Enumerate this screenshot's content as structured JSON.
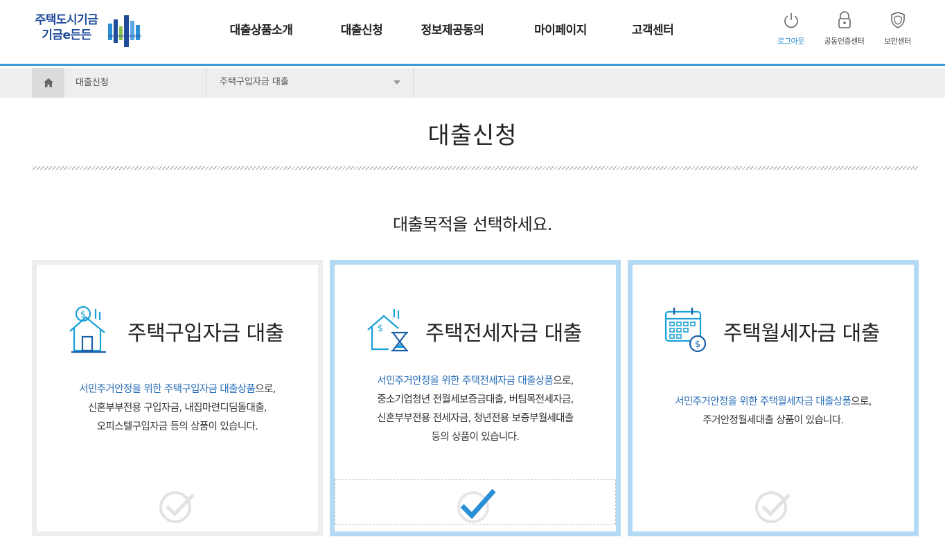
{
  "logo": {
    "line1": "주택도시기금",
    "line2": "기금e든든"
  },
  "gnb": [
    "대출상품소개",
    "대출신청",
    "정보제공동의",
    "마이페이지",
    "고객센터"
  ],
  "utils": [
    {
      "label": "로그아웃",
      "icon": "power-icon"
    },
    {
      "label": "공동인증센터",
      "icon": "lock-icon"
    },
    {
      "label": "보안센터",
      "icon": "shield-icon"
    }
  ],
  "breadcrumb": {
    "level1": "대출신청",
    "level2": "주택구입자금 대출"
  },
  "page": {
    "title": "대출신청",
    "prompt": "대출목적을 선택하세요."
  },
  "cards": [
    {
      "title": "주택구입자금 대출",
      "hl": "서민주거안정을 위한 주택구입자금 대출상품",
      "rest": "으로,",
      "lines": [
        "신혼부부전용 구입자금, 내집마련디딤돌대출,",
        "오피스텔구입자금 등의 상품이 있습니다."
      ],
      "icon": "house-purchase-icon"
    },
    {
      "title": "주택전세자금 대출",
      "hl": "서민주거안정을 위한 주택전세자금 대출상품",
      "rest": "으로,",
      "lines": [
        "중소기업청년 전월세보증금대출, 버팀목전세자금,",
        "신혼부부전용 전세자금, 청년전용 보증부월세대출",
        "등의 상품이 있습니다."
      ],
      "icon": "house-lease-icon"
    },
    {
      "title": "주택월세자금 대출",
      "hl": "서민주거안정을 위한 주택월세자금 대출상품",
      "rest": "으로,",
      "lines": [
        "주거안정월세대출 상품이 있습니다."
      ],
      "icon": "calendar-rent-icon"
    }
  ],
  "colors": {
    "accent": "#2b8fd6",
    "selected_border": "#b3d9f5",
    "brand": "#1f4b9a"
  }
}
